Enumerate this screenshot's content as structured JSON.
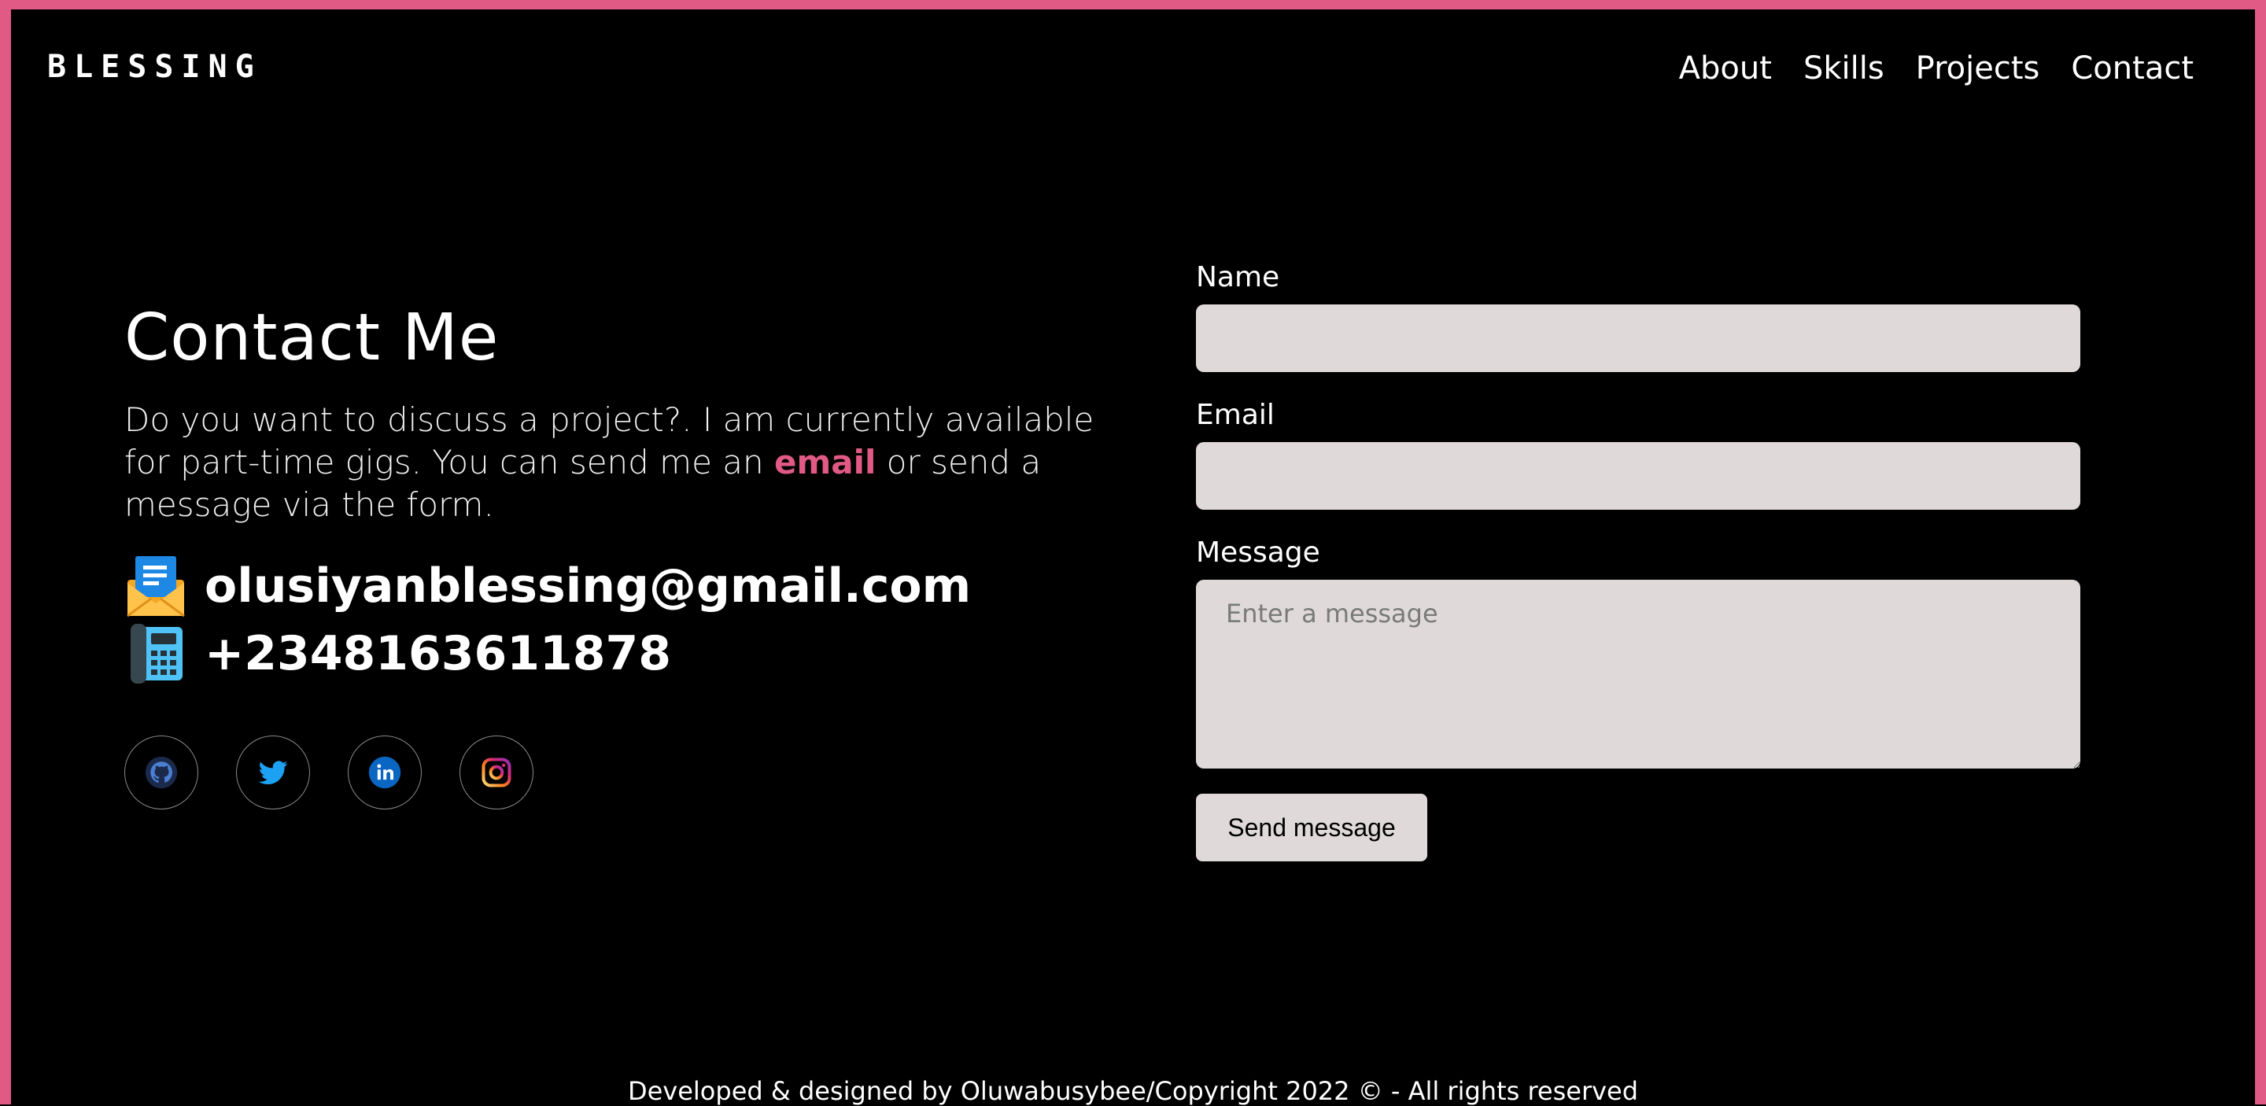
{
  "brand": {
    "logo": "BLESSING"
  },
  "nav": {
    "items": [
      {
        "label": "About"
      },
      {
        "label": "Skills"
      },
      {
        "label": "Projects"
      },
      {
        "label": "Contact"
      }
    ]
  },
  "contact": {
    "title": "Contact Me",
    "intro_before": "Do you want to discuss a project?. I am currently available for part-time gigs. You can send me an ",
    "intro_link": "email",
    "intro_after": " or send a message via the form.",
    "email": "olusiyanblessing@gmail.com",
    "phone": "+2348163611878",
    "email_icon": "envelope-icon",
    "phone_icon": "telephone-icon"
  },
  "socials": [
    {
      "name": "github-icon"
    },
    {
      "name": "twitter-icon"
    },
    {
      "name": "linkedin-icon"
    },
    {
      "name": "instagram-icon"
    }
  ],
  "form": {
    "name_label": "Name",
    "name_value": "",
    "email_label": "Email",
    "email_value": "",
    "message_label": "Message",
    "message_placeholder": "Enter a message",
    "send_label": "Send message"
  },
  "footer": {
    "text": "Developed & designed by Oluwabusybee/Copyright 2022 © - All rights reserved"
  },
  "colors": {
    "accent": "#e15a86",
    "field_bg": "#dfd9d9",
    "background": "#000000"
  }
}
